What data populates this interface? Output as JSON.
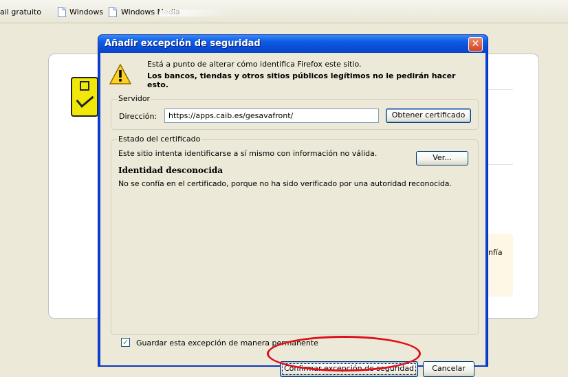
{
  "bookmarks": {
    "items": [
      {
        "label": "ail gratuito"
      },
      {
        "label": "Windows"
      },
      {
        "label": "Windows Media"
      }
    ]
  },
  "background_page": {
    "partial_text": "nfía"
  },
  "dialog": {
    "title": "Añadir excepción de seguridad",
    "close_glyph": "✕",
    "warning_line1": "Está a punto de alterar cómo identifica Firefox este sitio.",
    "warning_line2": "Los bancos, tiendas y otros sitios públicos legítimos no le pedirán hacer esto.",
    "server": {
      "legend": "Servidor",
      "address_label": "Dirección:",
      "address_value": "https://apps.caib.es/gesavafront/",
      "get_cert_button": "Obtener certificado"
    },
    "cert_status": {
      "legend": "Estado del certificado",
      "invalid_info": "Este sitio intenta identificarse a sí mismo con información no válida.",
      "view_button": "Ver...",
      "identity_heading": "Identidad desconocida",
      "identity_detail": "No se confía en el certificado, porque no ha sido verificado por una autoridad reconocida."
    },
    "permanent_checkbox": {
      "label": "Guardar esta excepción de manera permanente",
      "checked": true
    },
    "confirm_button": "Confirmar excepción de seguridad",
    "cancel_button": "Cancelar"
  },
  "colors": {
    "titlebar_blue": "#0a4dd6",
    "annotation_red": "#e0101a",
    "xp_background": "#ece9d8"
  },
  "icons": [
    "page-icon",
    "warning-icon",
    "close-icon",
    "checkmark-icon"
  ]
}
